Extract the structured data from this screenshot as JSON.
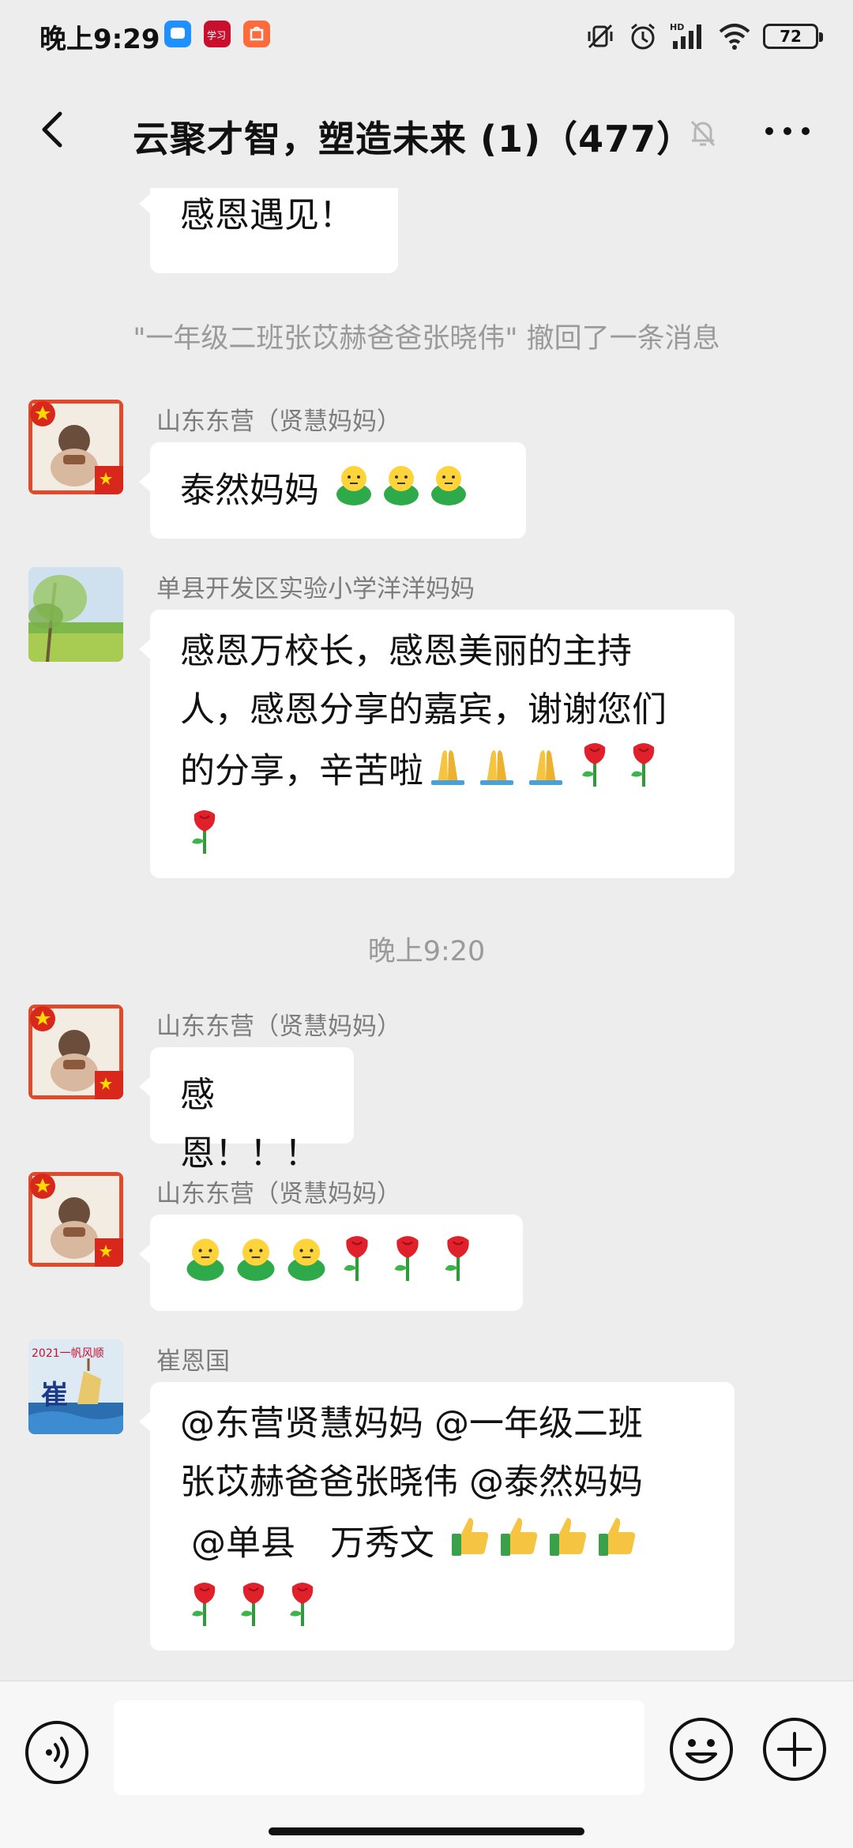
{
  "status_bar": {
    "time": "晚上9:29",
    "battery": "72",
    "network": "HD"
  },
  "header": {
    "title": "云聚才智，塑造未来 (1)（477）"
  },
  "messages": [
    {
      "text": "感恩遇见！"
    },
    {
      "system": "\"一年级二班张苡赫爸爸张晓伟\" 撤回了一条消息"
    },
    {
      "sender": "山东东营（贤慧妈妈）",
      "text": "泰然妈妈"
    },
    {
      "sender": "单县开发区实验小学洋洋妈妈",
      "lines": [
        "感恩万校长，感恩美丽的主持",
        "人，感恩分享的嘉宾，谢谢您们",
        "的分享，辛苦啦"
      ]
    },
    {
      "timestamp": "晚上9:20"
    },
    {
      "sender": "山东东营（贤慧妈妈）",
      "text": "感恩！！！"
    },
    {
      "sender": "山东东营（贤慧妈妈）"
    },
    {
      "sender": "崔恩国",
      "lines": [
        "@东营贤慧妈妈 @一年级二班",
        "张苡赫爸爸张晓伟 @泰然妈妈",
        " @单县　万秀文"
      ]
    }
  ],
  "avatar_cui": {
    "banner": "2021一帆风顺",
    "char": "崔"
  },
  "colors": {
    "bubble": "#ffffff",
    "background": "#ededed",
    "flag_red": "#d8281c",
    "flag_star": "#ffd800"
  }
}
